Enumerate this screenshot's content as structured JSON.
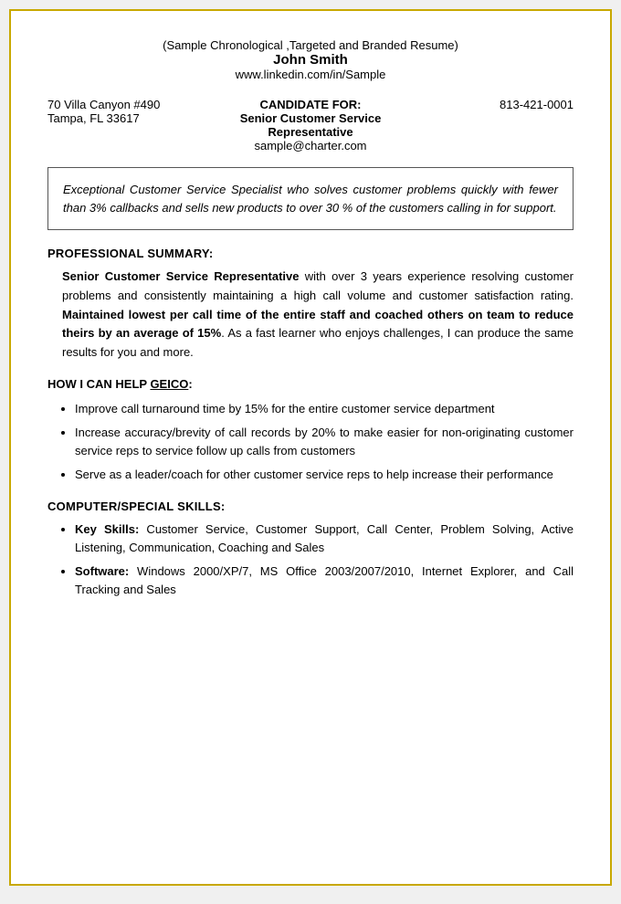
{
  "header": {
    "title": "(Sample Chronological ,Targeted and Branded Resume)",
    "name": "John Smith",
    "linkedin": "www.linkedin.com/in/Sample"
  },
  "contact": {
    "address1": "70 Villa Canyon #490",
    "address2": "Tampa, FL 33617",
    "candidate_label": "CANDIDATE FOR:",
    "candidate_title": "Senior Customer Service Representative",
    "email": "sample@charter.com",
    "phone": "813-421-0001"
  },
  "summary_box": {
    "text": "Exceptional Customer Service Specialist who solves customer problems quickly with fewer than 3% callbacks and sells new products to over 30 % of the customers calling in for support."
  },
  "professional_summary": {
    "heading": "PROFESSIONAL SUMMARY:",
    "text_bold": "Senior Customer Service Representative",
    "text_rest": " with over 3 years experience resolving customer problems and consistently maintaining a high call volume and customer satisfaction rating.",
    "text_bold2": "Maintained lowest per call time of the entire staff and coached others on team to reduce theirs by an average of 15%",
    "text_rest2": ".  As a fast learner who enjoys challenges, I can produce  the same results for you and more."
  },
  "geico_section": {
    "heading_pre": "HOW I CAN HELP ",
    "heading_company": "GEICO",
    "heading_post": ":",
    "bullets": [
      "Improve call turnaround time by 15% for the entire customer service department",
      "Increase accuracy/brevity of call records by 20% to make easier for non-originating customer service reps to service follow up calls from customers",
      "Serve as a leader/coach for other customer service reps to help increase their performance"
    ]
  },
  "skills_section": {
    "heading": "COMPUTER/SPECIAL  SKILLS:",
    "items": [
      {
        "label": "Key Skills:",
        "text": "  Customer Service, Customer Support, Call Center, Problem Solving, Active Listening, Communication, Coaching and Sales"
      },
      {
        "label": "Software:",
        "text": "  Windows 2000/XP/7, MS Office 2003/2007/2010, Internet Explorer, and Call Tracking and Sales"
      }
    ]
  }
}
